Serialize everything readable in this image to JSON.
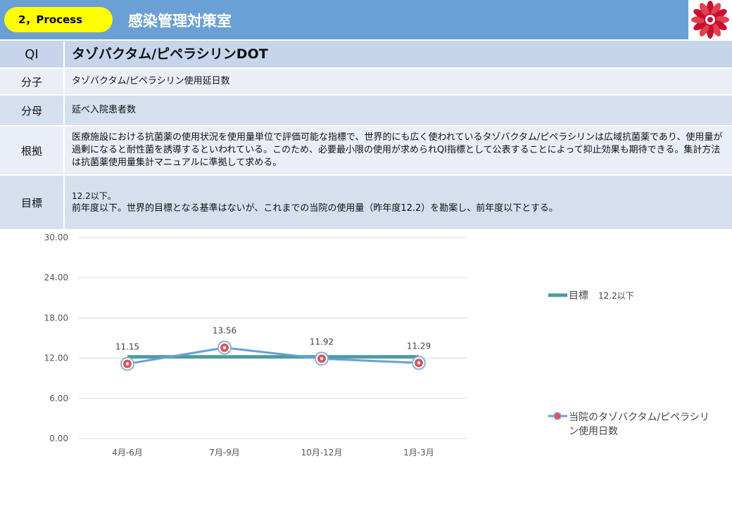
{
  "header": {
    "badge": "2，Process",
    "title": "感染管理対策室"
  },
  "logo": "red-flower-emblem-icon",
  "table": {
    "qi_label": "QI",
    "qi_title": "タゾバクタム/ピペラシリンDOT",
    "rows": [
      {
        "label": "分子",
        "value": "タゾバクタム/ピペラシリン使用延日数"
      },
      {
        "label": "分母",
        "value": "延べ入院患者数"
      },
      {
        "label": "根拠",
        "value": "医療施設における抗菌薬の使用状況を使用量単位で評価可能な指標で、世界的にも広く使われているタゾバクタム/ピペラシリンは広域抗菌薬であり、使用量が過剰になると耐性菌を誘導するといわれている。このため、必要最小限の使用が求められQI指標として公表することによって抑止効果も期待できる。集計方法は抗菌薬使用量集計マニュアルに準拠して求める。"
      },
      {
        "label": "目標",
        "line1": "12.2以下。",
        "line2": "前年度以下。世界的目標となる基準はないが、これまでの当院の使用量（昨年度12.2）を勘案し、前年度以下とする。"
      }
    ]
  },
  "chart_data": {
    "type": "line",
    "categories": [
      "4月-6月",
      "7月-9月",
      "10月-12月",
      "1月-3月"
    ],
    "series": [
      {
        "name": "目標　12.2以下",
        "values": [
          12.2,
          12.2,
          12.2,
          12.2
        ],
        "color": "#4f9a9a"
      },
      {
        "name": "当院のタゾバクタム/ピペラシリン使用日数",
        "values": [
          11.15,
          13.56,
          11.92,
          11.29
        ],
        "color": "#6a9fd4",
        "data_labels": [
          "11.15",
          "13.56",
          "11.92",
          "11.29"
        ]
      }
    ],
    "ylim": [
      0,
      30
    ],
    "yticks": [
      "0.00",
      "6.00",
      "12.00",
      "18.00",
      "24.00",
      "30.00"
    ],
    "grid": true,
    "legend_position": "right"
  }
}
